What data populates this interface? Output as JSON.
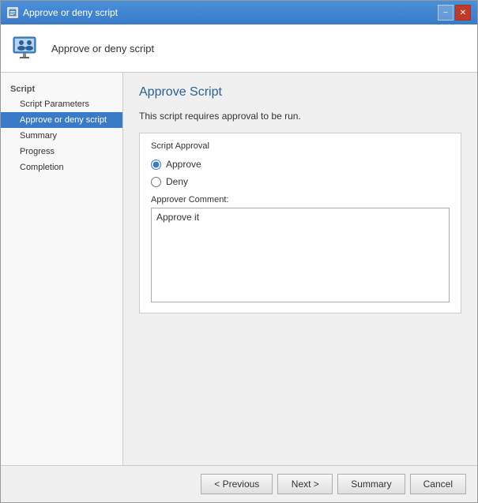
{
  "window": {
    "title": "Approve or deny script",
    "minimize_label": "−",
    "close_label": "✕"
  },
  "header": {
    "title": "Approve or deny script"
  },
  "sidebar": {
    "section_label": "Script",
    "items": [
      {
        "id": "script-parameters",
        "label": "Script Parameters",
        "active": false
      },
      {
        "id": "approve-or-deny-script",
        "label": "Approve or deny script",
        "active": true
      },
      {
        "id": "summary",
        "label": "Summary",
        "active": false
      },
      {
        "id": "progress",
        "label": "Progress",
        "active": false
      },
      {
        "id": "completion",
        "label": "Completion",
        "active": false
      }
    ]
  },
  "content": {
    "title": "Approve Script",
    "description": "This script requires approval to be run.",
    "group_box_title": "Script Approval",
    "approve_label": "Approve",
    "deny_label": "Deny",
    "comment_label": "Approver Comment:",
    "comment_value": "Approve it"
  },
  "footer": {
    "previous_label": "< Previous",
    "next_label": "Next >",
    "summary_label": "Summary",
    "cancel_label": "Cancel"
  }
}
